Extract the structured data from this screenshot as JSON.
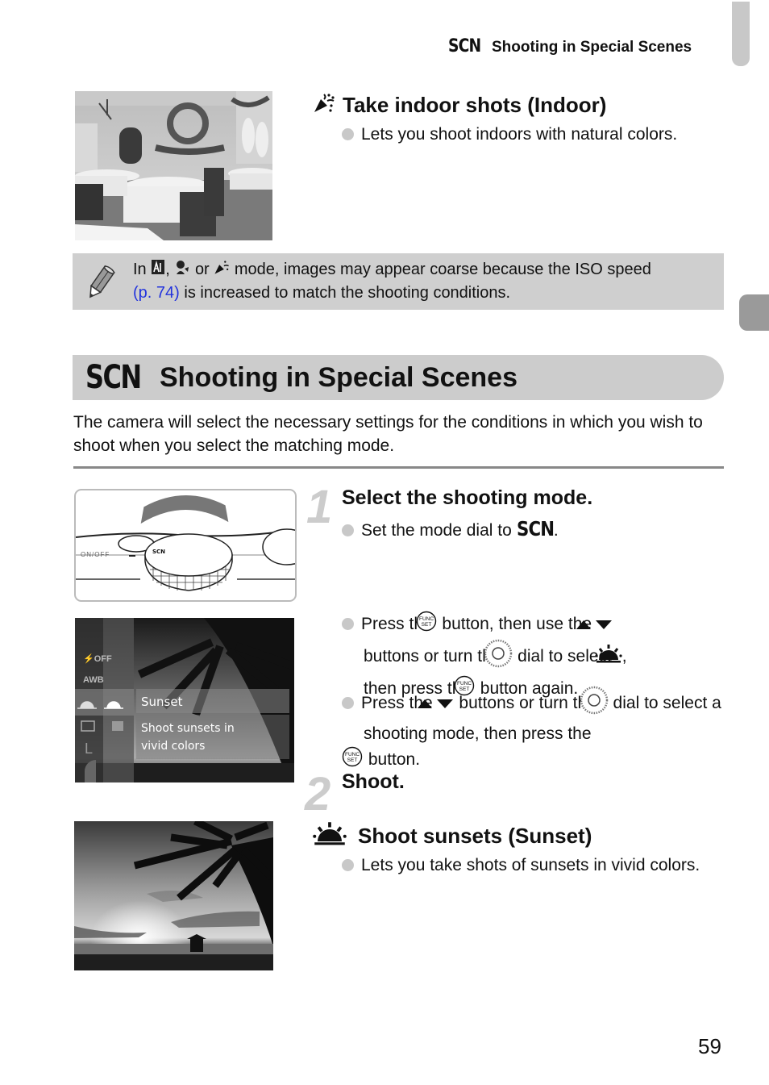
{
  "header": {
    "scn_label": "SCN",
    "running_title": "Shooting in Special Scenes"
  },
  "indoor": {
    "title": "Take indoor shots (Indoor)",
    "bullet": "Lets you shoot indoors with natural colors.",
    "icon": "party-indoor-icon"
  },
  "note": {
    "icon": "pencil-icon",
    "text_in": "In",
    "text_mid1": ",",
    "text_mid2": "or",
    "text_after": "mode, images may appear coarse because the ISO speed",
    "link": "(p. 74)",
    "text_end": "is increased to match the shooting conditions."
  },
  "section": {
    "scn_label": "SCN",
    "title": "Shooting in Special Scenes",
    "intro": "The camera will select the necessary settings for the conditions in which you wish to shoot when you select the matching mode."
  },
  "steps": [
    {
      "number": "1",
      "title": "Select the shooting mode.",
      "bullet1_text": "Set the mode dial to",
      "bullet1_scn": "SCN",
      "bullet1_end": ".",
      "dial_illustration": {
        "on_off_label": "ON/OFF",
        "dial_label": "SCN"
      }
    },
    {
      "number": "2",
      "title": "Shoot."
    }
  ],
  "instructions": {
    "b1_a": "Press the",
    "b1_b": "button, then use the",
    "b1_c": "buttons or turn the",
    "b1_d": "dial to select",
    "b1_e": ",",
    "b1_f": "then press the",
    "b1_g": "button again.",
    "b2_a": "Press the",
    "b2_b": "buttons or turn the",
    "b2_c": "dial to select a shooting mode, then press the",
    "b2_d": "button."
  },
  "screen": {
    "menu_items": [
      "⚡OFF",
      "AWB"
    ],
    "selected_label": "Sunset",
    "description_line1": "Shoot sunsets in",
    "description_line2": "vivid colors",
    "side_letter": "L"
  },
  "sunset": {
    "title": "Shoot sunsets (Sunset)",
    "bullet": "Lets you take shots of sunsets in vivid colors.",
    "icon": "sunset-icon"
  },
  "page_number": "59"
}
